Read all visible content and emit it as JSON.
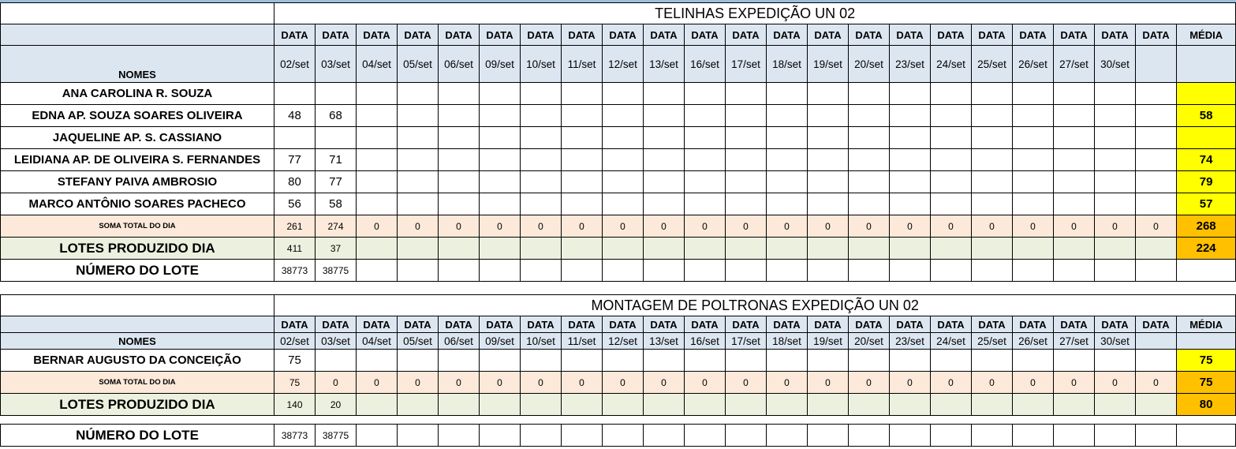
{
  "dates": [
    "02/set",
    "03/set",
    "04/set",
    "05/set",
    "06/set",
    "09/set",
    "10/set",
    "11/set",
    "12/set",
    "13/set",
    "16/set",
    "17/set",
    "18/set",
    "19/set",
    "20/set",
    "23/set",
    "24/set",
    "25/set",
    "26/set",
    "27/set",
    "30/set",
    ""
  ],
  "data_label": "DATA",
  "media_label": "MÉDIA",
  "nomes_label": "NOMES",
  "section1": {
    "title": "TELINHAS EXPEDIÇÃO UN 02",
    "rows": [
      {
        "name": "ANA CAROLINA R. SOUZA",
        "v1": "",
        "v2": "",
        "avg": ""
      },
      {
        "name": "EDNA AP. SOUZA SOARES OLIVEIRA",
        "v1": "48",
        "v2": "68",
        "avg": "58"
      },
      {
        "name": "JAQUELINE AP.  S. CASSIANO",
        "v1": "",
        "v2": "",
        "avg": ""
      },
      {
        "name": "LEIDIANA AP. DE OLIVEIRA S. FERNANDES",
        "v1": "77",
        "v2": "71",
        "avg": "74"
      },
      {
        "name": "STEFANY PAIVA AMBROSIO",
        "v1": "80",
        "v2": "77",
        "avg": "79"
      },
      {
        "name": "MARCO ANTÔNIO SOARES PACHECO",
        "v1": "56",
        "v2": "58",
        "avg": "57"
      }
    ],
    "soma_label": "SOMA TOTAL DO DIA",
    "soma_values": [
      "261",
      "274",
      "0",
      "0",
      "0",
      "0",
      "0",
      "0",
      "0",
      "0",
      "0",
      "0",
      "0",
      "0",
      "0",
      "0",
      "0",
      "0",
      "0",
      "0",
      "0",
      "0"
    ],
    "soma_avg": "268",
    "lotes_label": "LOTES PRODUZIDO DIA",
    "lotes_values": [
      "411",
      "37"
    ],
    "lotes_avg": "224",
    "numero_label": "NÚMERO DO LOTE",
    "numero_values": [
      "38773",
      "38775"
    ]
  },
  "section2": {
    "title": "MONTAGEM DE POLTRONAS EXPEDIÇÃO UN 02",
    "rows": [
      {
        "name": "BERNAR AUGUSTO DA CONCEIÇÃO",
        "v1": "75",
        "v2": "",
        "avg": "75"
      }
    ],
    "soma_label": "SOMA TOTAL DO DIA",
    "soma_values": [
      "75",
      "0",
      "0",
      "0",
      "0",
      "0",
      "0",
      "0",
      "0",
      "0",
      "0",
      "0",
      "0",
      "0",
      "0",
      "0",
      "0",
      "0",
      "0",
      "0",
      "0",
      "0"
    ],
    "soma_avg": "75",
    "lotes_label": "LOTES PRODUZIDO DIA",
    "lotes_values": [
      "140",
      "20"
    ],
    "lotes_avg": "80",
    "numero_label": "NÚMERO DO LOTE",
    "numero_values": [
      "38773",
      "38775"
    ]
  }
}
